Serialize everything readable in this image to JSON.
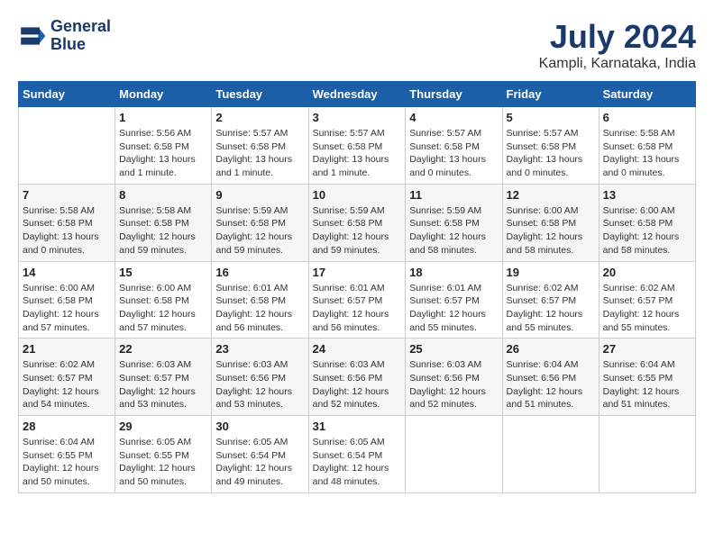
{
  "header": {
    "logo_line1": "General",
    "logo_line2": "Blue",
    "month": "July 2024",
    "location": "Kampli, Karnataka, India"
  },
  "weekdays": [
    "Sunday",
    "Monday",
    "Tuesday",
    "Wednesday",
    "Thursday",
    "Friday",
    "Saturday"
  ],
  "weeks": [
    [
      {
        "day": "",
        "sunrise": "",
        "sunset": "",
        "daylight": ""
      },
      {
        "day": "1",
        "sunrise": "Sunrise: 5:56 AM",
        "sunset": "Sunset: 6:58 PM",
        "daylight": "Daylight: 13 hours and 1 minute."
      },
      {
        "day": "2",
        "sunrise": "Sunrise: 5:57 AM",
        "sunset": "Sunset: 6:58 PM",
        "daylight": "Daylight: 13 hours and 1 minute."
      },
      {
        "day": "3",
        "sunrise": "Sunrise: 5:57 AM",
        "sunset": "Sunset: 6:58 PM",
        "daylight": "Daylight: 13 hours and 1 minute."
      },
      {
        "day": "4",
        "sunrise": "Sunrise: 5:57 AM",
        "sunset": "Sunset: 6:58 PM",
        "daylight": "Daylight: 13 hours and 0 minutes."
      },
      {
        "day": "5",
        "sunrise": "Sunrise: 5:57 AM",
        "sunset": "Sunset: 6:58 PM",
        "daylight": "Daylight: 13 hours and 0 minutes."
      },
      {
        "day": "6",
        "sunrise": "Sunrise: 5:58 AM",
        "sunset": "Sunset: 6:58 PM",
        "daylight": "Daylight: 13 hours and 0 minutes."
      }
    ],
    [
      {
        "day": "7",
        "sunrise": "Sunrise: 5:58 AM",
        "sunset": "Sunset: 6:58 PM",
        "daylight": "Daylight: 13 hours and 0 minutes."
      },
      {
        "day": "8",
        "sunrise": "Sunrise: 5:58 AM",
        "sunset": "Sunset: 6:58 PM",
        "daylight": "Daylight: 12 hours and 59 minutes."
      },
      {
        "day": "9",
        "sunrise": "Sunrise: 5:59 AM",
        "sunset": "Sunset: 6:58 PM",
        "daylight": "Daylight: 12 hours and 59 minutes."
      },
      {
        "day": "10",
        "sunrise": "Sunrise: 5:59 AM",
        "sunset": "Sunset: 6:58 PM",
        "daylight": "Daylight: 12 hours and 59 minutes."
      },
      {
        "day": "11",
        "sunrise": "Sunrise: 5:59 AM",
        "sunset": "Sunset: 6:58 PM",
        "daylight": "Daylight: 12 hours and 58 minutes."
      },
      {
        "day": "12",
        "sunrise": "Sunrise: 6:00 AM",
        "sunset": "Sunset: 6:58 PM",
        "daylight": "Daylight: 12 hours and 58 minutes."
      },
      {
        "day": "13",
        "sunrise": "Sunrise: 6:00 AM",
        "sunset": "Sunset: 6:58 PM",
        "daylight": "Daylight: 12 hours and 58 minutes."
      }
    ],
    [
      {
        "day": "14",
        "sunrise": "Sunrise: 6:00 AM",
        "sunset": "Sunset: 6:58 PM",
        "daylight": "Daylight: 12 hours and 57 minutes."
      },
      {
        "day": "15",
        "sunrise": "Sunrise: 6:00 AM",
        "sunset": "Sunset: 6:58 PM",
        "daylight": "Daylight: 12 hours and 57 minutes."
      },
      {
        "day": "16",
        "sunrise": "Sunrise: 6:01 AM",
        "sunset": "Sunset: 6:58 PM",
        "daylight": "Daylight: 12 hours and 56 minutes."
      },
      {
        "day": "17",
        "sunrise": "Sunrise: 6:01 AM",
        "sunset": "Sunset: 6:57 PM",
        "daylight": "Daylight: 12 hours and 56 minutes."
      },
      {
        "day": "18",
        "sunrise": "Sunrise: 6:01 AM",
        "sunset": "Sunset: 6:57 PM",
        "daylight": "Daylight: 12 hours and 55 minutes."
      },
      {
        "day": "19",
        "sunrise": "Sunrise: 6:02 AM",
        "sunset": "Sunset: 6:57 PM",
        "daylight": "Daylight: 12 hours and 55 minutes."
      },
      {
        "day": "20",
        "sunrise": "Sunrise: 6:02 AM",
        "sunset": "Sunset: 6:57 PM",
        "daylight": "Daylight: 12 hours and 55 minutes."
      }
    ],
    [
      {
        "day": "21",
        "sunrise": "Sunrise: 6:02 AM",
        "sunset": "Sunset: 6:57 PM",
        "daylight": "Daylight: 12 hours and 54 minutes."
      },
      {
        "day": "22",
        "sunrise": "Sunrise: 6:03 AM",
        "sunset": "Sunset: 6:57 PM",
        "daylight": "Daylight: 12 hours and 53 minutes."
      },
      {
        "day": "23",
        "sunrise": "Sunrise: 6:03 AM",
        "sunset": "Sunset: 6:56 PM",
        "daylight": "Daylight: 12 hours and 53 minutes."
      },
      {
        "day": "24",
        "sunrise": "Sunrise: 6:03 AM",
        "sunset": "Sunset: 6:56 PM",
        "daylight": "Daylight: 12 hours and 52 minutes."
      },
      {
        "day": "25",
        "sunrise": "Sunrise: 6:03 AM",
        "sunset": "Sunset: 6:56 PM",
        "daylight": "Daylight: 12 hours and 52 minutes."
      },
      {
        "day": "26",
        "sunrise": "Sunrise: 6:04 AM",
        "sunset": "Sunset: 6:56 PM",
        "daylight": "Daylight: 12 hours and 51 minutes."
      },
      {
        "day": "27",
        "sunrise": "Sunrise: 6:04 AM",
        "sunset": "Sunset: 6:55 PM",
        "daylight": "Daylight: 12 hours and 51 minutes."
      }
    ],
    [
      {
        "day": "28",
        "sunrise": "Sunrise: 6:04 AM",
        "sunset": "Sunset: 6:55 PM",
        "daylight": "Daylight: 12 hours and 50 minutes."
      },
      {
        "day": "29",
        "sunrise": "Sunrise: 6:05 AM",
        "sunset": "Sunset: 6:55 PM",
        "daylight": "Daylight: 12 hours and 50 minutes."
      },
      {
        "day": "30",
        "sunrise": "Sunrise: 6:05 AM",
        "sunset": "Sunset: 6:54 PM",
        "daylight": "Daylight: 12 hours and 49 minutes."
      },
      {
        "day": "31",
        "sunrise": "Sunrise: 6:05 AM",
        "sunset": "Sunset: 6:54 PM",
        "daylight": "Daylight: 12 hours and 48 minutes."
      },
      {
        "day": "",
        "sunrise": "",
        "sunset": "",
        "daylight": ""
      },
      {
        "day": "",
        "sunrise": "",
        "sunset": "",
        "daylight": ""
      },
      {
        "day": "",
        "sunrise": "",
        "sunset": "",
        "daylight": ""
      }
    ]
  ]
}
